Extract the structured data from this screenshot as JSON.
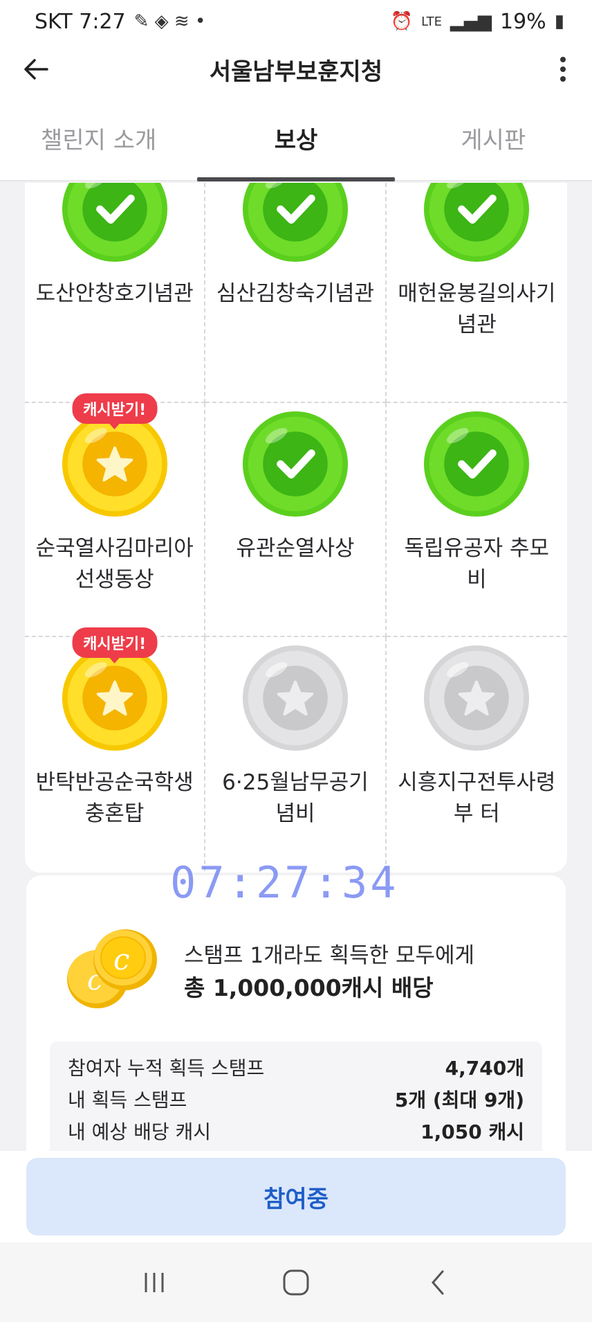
{
  "status_bar": {
    "carrier_time": "SKT 7:27",
    "network": "LTE",
    "battery": "19%"
  },
  "app_bar": {
    "title": "서울남부보훈지청"
  },
  "tabs": [
    {
      "label": "챌린지 소개",
      "active": false
    },
    {
      "label": "보상",
      "active": true
    },
    {
      "label": "게시판",
      "active": false
    }
  ],
  "stamps": [
    {
      "name": "도산안창호기념관",
      "state": "collected",
      "badge": ""
    },
    {
      "name": "심산김창숙기념관",
      "state": "collected",
      "badge": ""
    },
    {
      "name": "매헌윤봉길의사기념관",
      "state": "collected",
      "badge": ""
    },
    {
      "name": "순국열사김마리아선생동상",
      "state": "gold",
      "badge": "캐시받기!"
    },
    {
      "name": "유관순열사상",
      "state": "collected",
      "badge": ""
    },
    {
      "name": "독립유공자 추모비",
      "state": "collected",
      "badge": ""
    },
    {
      "name": "반탁반공순국학생 충혼탑",
      "state": "gold",
      "badge": "캐시받기!"
    },
    {
      "name": "6·25월남무공기념비",
      "state": "locked",
      "badge": ""
    },
    {
      "name": "시흥지구전투사령부 터",
      "state": "locked",
      "badge": ""
    }
  ],
  "reward": {
    "line1": "스탬프 1개라도 획득한 모두에게",
    "line2": "총 1,000,000캐시 배당",
    "stats": [
      {
        "label": "참여자 누적 획득 스탬프",
        "value": "4,740개"
      },
      {
        "label": "내 획득 스탬프",
        "value": "5개 (최대 9개)"
      },
      {
        "label": "내 예상 배당 캐시",
        "value": "1,050 캐시"
      }
    ]
  },
  "clock_overlay": "07:27:34",
  "join_button": "참여중",
  "colors": {
    "accent": "#1f5ec8",
    "collected": "#3cb515",
    "gold": "#f5b400",
    "locked": "#c9c9cc",
    "badge": "#ee3c4a"
  }
}
